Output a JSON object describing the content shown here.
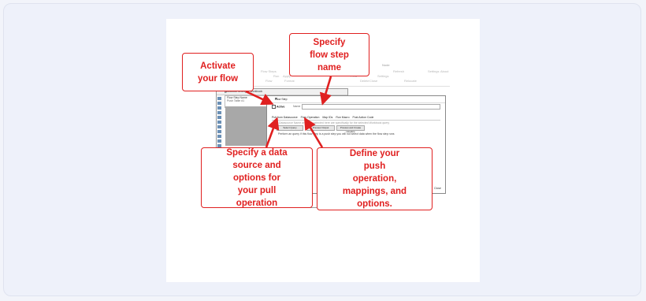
{
  "ribbon": {
    "labels": [
      "Flow Steps",
      "Run",
      "Apply",
      "Flow",
      "Format",
      "Flow",
      "Delete",
      "Close",
      "Settings",
      "Refresh",
      "Relocate",
      "Settings",
      "About",
      "Node"
    ]
  },
  "workbook_window": {
    "title": "Workbook Settings - Workbook",
    "list_header": "Flow Step Name",
    "list_item": "Push Table #1"
  },
  "flow_step_dialog": {
    "title": "Flow Step",
    "active_label": "Active",
    "name_label": "Name",
    "tabs": [
      "Pull from Datasource",
      "Flow Operation",
      "Map IDs",
      "Run Macro",
      "Post Action Code"
    ],
    "info_text": "The Datasource Name and URL selected here are specifically for the selected Workbook query",
    "buttons": [
      "Select Query",
      "Preview Output",
      "Preview and Create Headers"
    ],
    "hint_text": "Perform an query if this flow step is a push step you will not select data when the flow step runs",
    "close_label": "Close"
  },
  "callouts": {
    "activate": "Activate\nyour flow",
    "name": "Specify\nflow step\nname",
    "pull": "Specify a data\nsource and\noptions for\nyour pull\noperation",
    "push": "Define your\npush\noperation,\nmappings, and\noptions."
  },
  "colors": {
    "accent": "#e02020",
    "page_background": "#eef1fa",
    "canvas": "#ffffff"
  }
}
